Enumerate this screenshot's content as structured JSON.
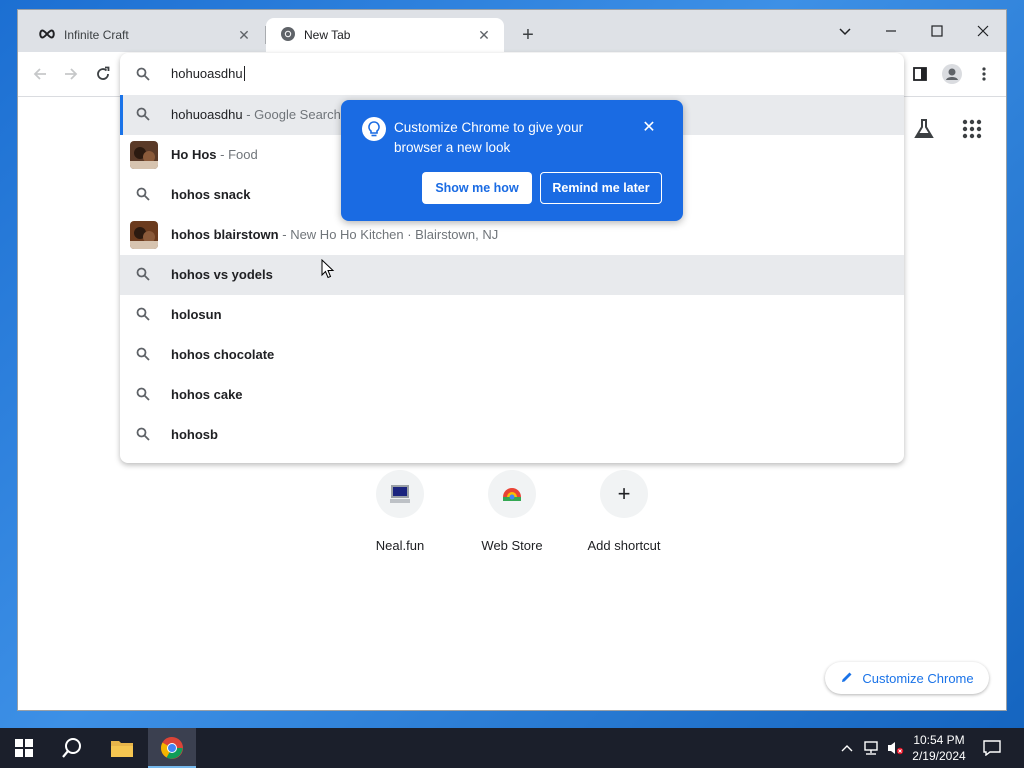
{
  "tabs": [
    {
      "title": "Infinite Craft",
      "icon": "infinity-icon",
      "active": false
    },
    {
      "title": "New Tab",
      "icon": "chrome-icon",
      "active": true
    }
  ],
  "omnibox": {
    "input_value": "hohuoasdhu",
    "suggestions": [
      {
        "main": "hohuoasdhu",
        "desc": "- Google Search",
        "icon": "search-icon",
        "selected": true
      },
      {
        "main": "Ho Hos",
        "desc": "- Food",
        "icon": "thumbnail",
        "thumb_color": "#5a3a28"
      },
      {
        "main": "hohos snack",
        "desc": "",
        "icon": "search-icon"
      },
      {
        "main": "hohos blairstown",
        "desc": "- New Ho Ho Kitchen · Blairstown, NJ",
        "icon": "thumbnail",
        "thumb_color": "#6b3b1e"
      },
      {
        "main": "hohos vs yodels",
        "desc": "",
        "icon": "search-icon",
        "hover": true
      },
      {
        "main": "holosun",
        "desc": "",
        "icon": "search-icon"
      },
      {
        "main": "hohos chocolate",
        "desc": "",
        "icon": "search-icon"
      },
      {
        "main": "hohos cake",
        "desc": "",
        "icon": "search-icon"
      },
      {
        "main": "hohosb",
        "desc": "",
        "icon": "search-icon"
      }
    ]
  },
  "promo": {
    "message": "Customize Chrome to give your browser a new look",
    "show_label": "Show me how",
    "later_label": "Remind me later",
    "color": "#1a6be3"
  },
  "shortcuts": [
    {
      "label": "Neal.fun",
      "icon": "computer-icon"
    },
    {
      "label": "Web Store",
      "icon": "webstore-icon"
    },
    {
      "label": "Add shortcut",
      "icon": "plus-icon"
    }
  ],
  "customize_button": {
    "label": "Customize Chrome"
  },
  "taskbar": {
    "time": "10:54 PM",
    "date": "2/19/2024"
  },
  "colors": {
    "accent": "#1a73e8",
    "taskbar": "#1b1f2b"
  }
}
